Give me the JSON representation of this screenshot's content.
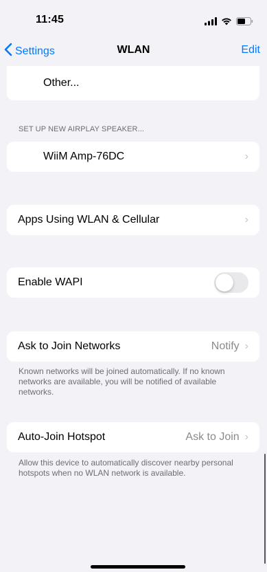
{
  "status_bar": {
    "time": "11:45",
    "icons": [
      "cellular-signal-icon",
      "wifi-icon",
      "battery-icon"
    ]
  },
  "nav": {
    "back_label": "Settings",
    "title": "WLAN",
    "edit_label": "Edit"
  },
  "other_network": {
    "label": "Other..."
  },
  "airplay": {
    "header": "SET UP NEW AIRPLAY SPEAKER...",
    "device_label": "WiiM Amp-76DC"
  },
  "apps_using": {
    "label": "Apps Using WLAN & Cellular"
  },
  "wapi": {
    "label": "Enable WAPI",
    "enabled": false
  },
  "ask_to_join": {
    "label": "Ask to Join Networks",
    "value": "Notify",
    "footer": "Known networks will be joined automatically. If no known networks are available, you will be notified of available networks."
  },
  "auto_join_hotspot": {
    "label": "Auto-Join Hotspot",
    "value": "Ask to Join",
    "footer": "Allow this device to automatically discover nearby personal hotspots when no WLAN network is available."
  },
  "colors": {
    "accent": "#007aff",
    "background": "#f2f2f7",
    "secondary_text": "#8a8a8e",
    "toggle_off": "#e9e9eb"
  }
}
